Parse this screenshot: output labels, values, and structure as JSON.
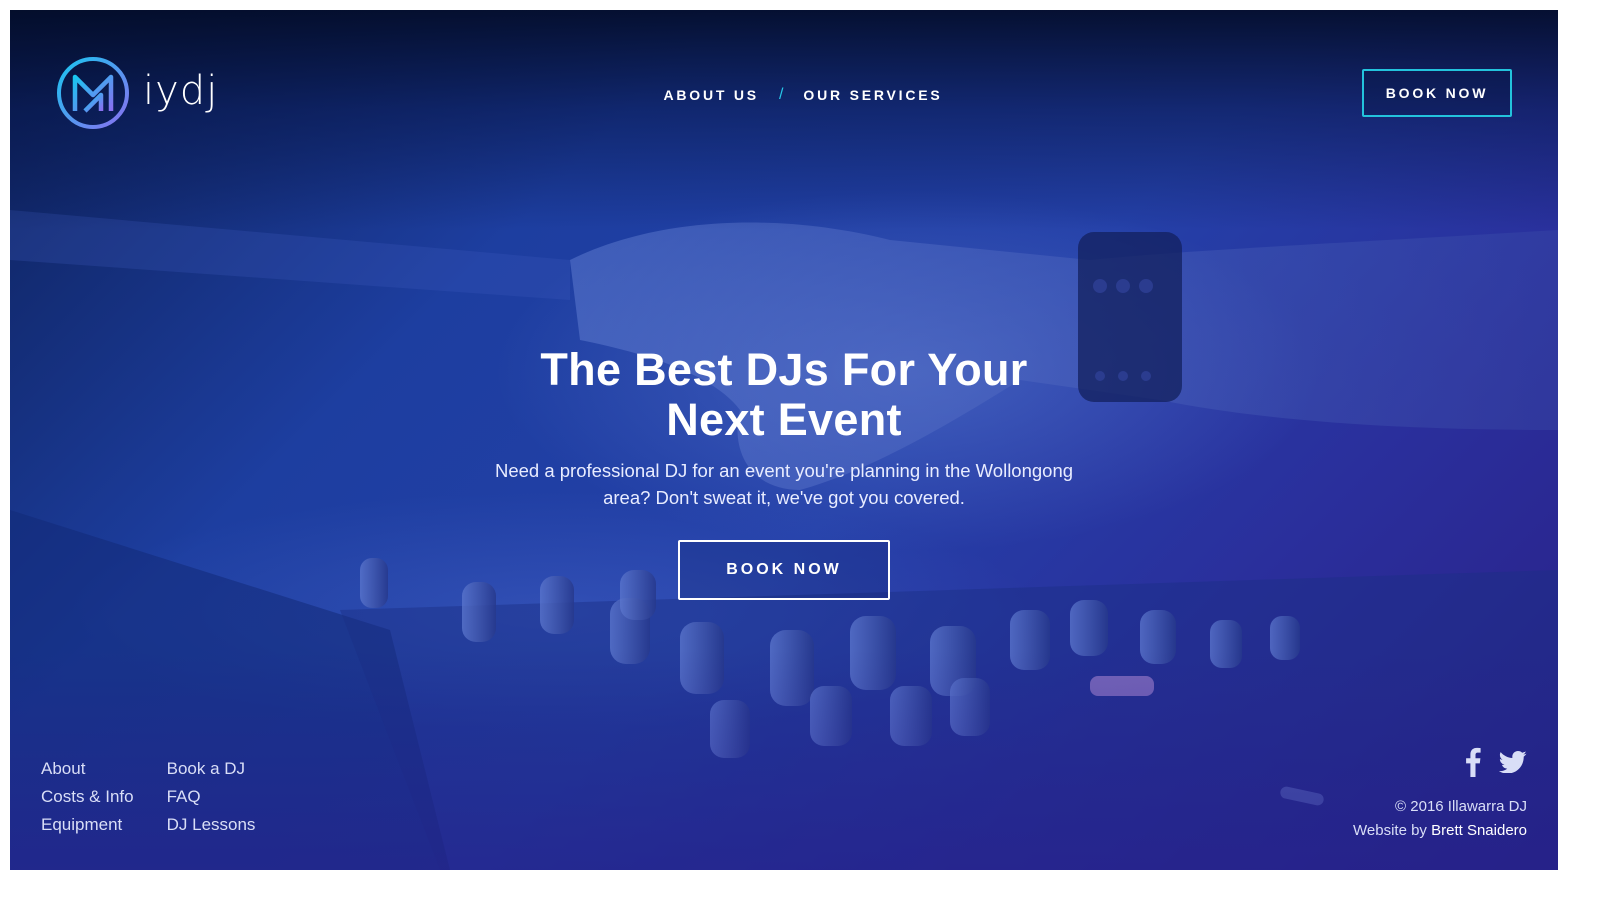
{
  "header": {
    "logo_text": "iydj",
    "nav": [
      {
        "label": "ABOUT US"
      },
      {
        "label": "OUR SERVICES"
      }
    ],
    "nav_separator": "/",
    "book_label": "BOOK NOW"
  },
  "hero": {
    "title_line1": "The Best DJs For Your",
    "title_line2": "Next Event",
    "subtitle": "Need a professional DJ for an event you're planning in the Wollongong area? Don't sweat it, we've got you covered.",
    "button_label": "BOOK NOW"
  },
  "footer": {
    "links_col1": [
      "About",
      "Costs & Info",
      "Equipment"
    ],
    "links_col2": [
      "Book a DJ",
      "FAQ",
      "DJ Lessons"
    ],
    "copyright": "© 2016 Illawarra DJ",
    "credit_prefix": "Website by",
    "credit_name": "Brett Snaidero",
    "social": [
      "facebook-icon",
      "twitter-icon"
    ]
  },
  "colors": {
    "accent": "#23c3dc",
    "logo_gradient_start": "#19c6f0",
    "logo_gradient_end": "#8a6ff0",
    "background_start": "#0c1f55",
    "background_end": "#2a1f86"
  }
}
